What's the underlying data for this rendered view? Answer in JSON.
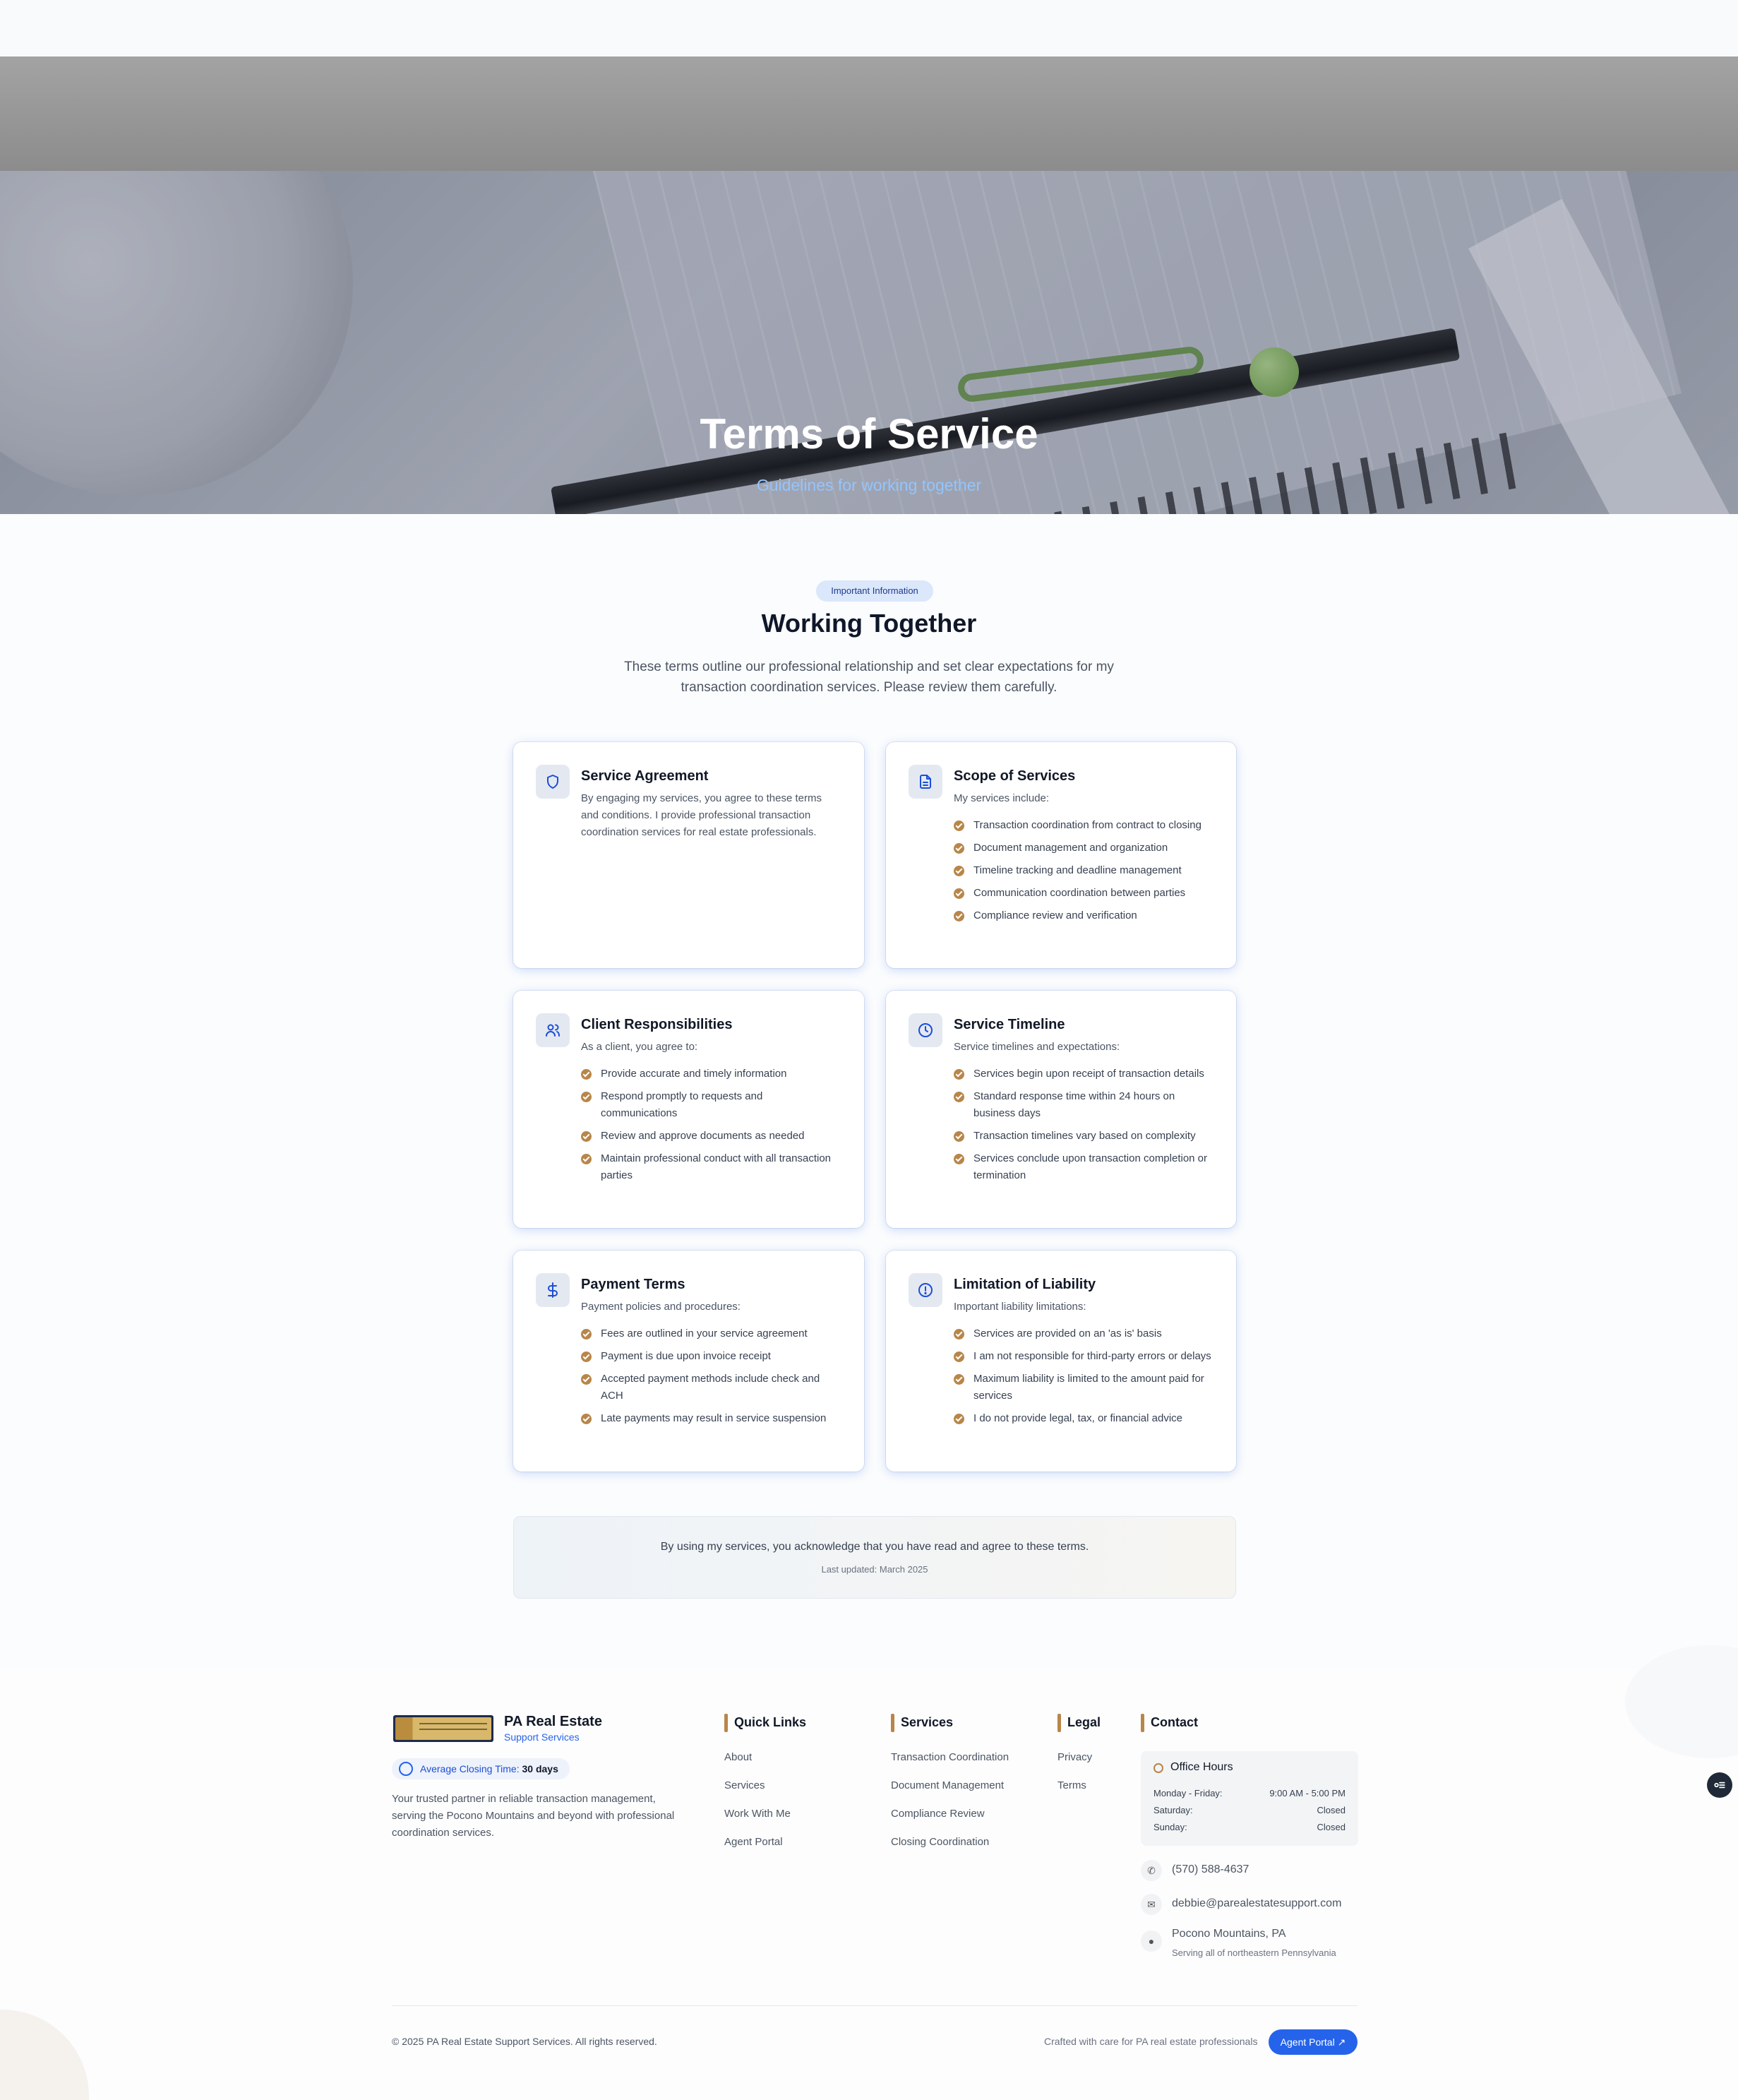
{
  "hero": {
    "title": "Terms of Service",
    "subtitle": "Guidelines for working together"
  },
  "intro": {
    "badge": "Important Information",
    "title": "Working Together",
    "description": "These terms outline our professional relationship and set clear expectations for my transaction coordination services. Please review them carefully."
  },
  "cards": [
    {
      "icon": "shield-icon",
      "title": "Service Agreement",
      "intro": "By engaging my services, you agree to these terms and conditions. I provide professional transaction coordination services for real estate professionals.",
      "items": []
    },
    {
      "icon": "document-icon",
      "title": "Scope of Services",
      "intro": "My services include:",
      "items": [
        "Transaction coordination from contract to closing",
        "Document management and organization",
        "Timeline tracking and deadline management",
        "Communication coordination between parties",
        "Compliance review and verification"
      ]
    },
    {
      "icon": "users-icon",
      "title": "Client Responsibilities",
      "intro": "As a client, you agree to:",
      "items": [
        "Provide accurate and timely information",
        "Respond promptly to requests and communications",
        "Review and approve documents as needed",
        "Maintain professional conduct with all transaction parties"
      ]
    },
    {
      "icon": "clock-icon",
      "title": "Service Timeline",
      "intro": "Service timelines and expectations:",
      "items": [
        "Services begin upon receipt of transaction details",
        "Standard response time within 24 hours on business days",
        "Transaction timelines vary based on complexity",
        "Services conclude upon transaction completion or termination"
      ]
    },
    {
      "icon": "dollar-icon",
      "title": "Payment Terms",
      "intro": "Payment policies and procedures:",
      "items": [
        "Fees are outlined in your service agreement",
        "Payment is due upon invoice receipt",
        "Accepted payment methods include check and ACH",
        "Late payments may result in service suspension"
      ]
    },
    {
      "icon": "alert-circle-icon",
      "title": "Limitation of Liability",
      "intro": "Important liability limitations:",
      "items": [
        "Services are provided on an 'as is' basis",
        "I am not responsible for third-party errors or delays",
        "Maximum liability is limited to the amount paid for services",
        "I do not provide legal, tax, or financial advice"
      ]
    }
  ],
  "acknowledgement": {
    "text": "By using my services, you acknowledge that you have read and agree to these terms.",
    "updated": "Last updated: March 2025"
  },
  "footer": {
    "brand": {
      "name": "PA Real Estate",
      "sub": "Support Services",
      "closing_label": "Average Closing Time:",
      "closing_value": "30 days",
      "description": "Your trusted partner in reliable transaction management, serving the Pocono Mountains and beyond with professional coordination services.",
      "logo_text": "PA REAL ESTATE Support Services, llc"
    },
    "quick_links": {
      "title": "Quick Links",
      "items": [
        "About",
        "Services",
        "Work With Me",
        "Agent Portal"
      ]
    },
    "services": {
      "title": "Services",
      "items": [
        "Transaction Coordination",
        "Document Management",
        "Compliance Review",
        "Closing Coordination"
      ]
    },
    "legal": {
      "title": "Legal",
      "items": [
        "Privacy",
        "Terms"
      ]
    },
    "contact": {
      "title": "Contact",
      "hours_title": "Office Hours",
      "hours": [
        {
          "day": "Monday - Friday:",
          "time": "9:00 AM - 5:00 PM"
        },
        {
          "day": "Saturday:",
          "time": "Closed"
        },
        {
          "day": "Sunday:",
          "time": "Closed"
        }
      ],
      "phone": "(570) 588-4637",
      "email": "debbie@parealestatesupport.com",
      "location": "Pocono Mountains, PA",
      "location_note": "Serving all of northeastern Pennsylvania"
    },
    "copyright": "© 2025 PA Real Estate Support Services. All rights reserved.",
    "crafted": "Crafted with care for PA real estate professionals",
    "portal_button": "Agent Portal"
  },
  "colors": {
    "accent": "#2563eb",
    "gold": "#b8864a",
    "hero_subtitle": "#93c5fd"
  }
}
